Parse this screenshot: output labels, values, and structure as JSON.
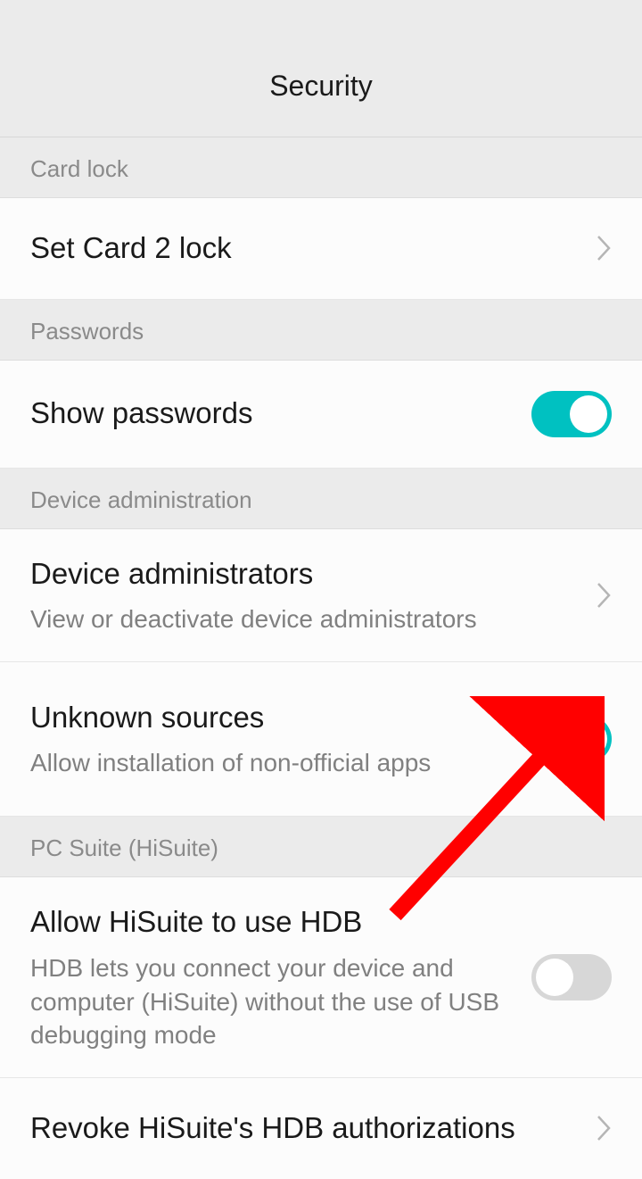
{
  "header": {
    "title": "Security"
  },
  "sections": {
    "card_lock": {
      "header": "Card lock",
      "set_card_lock": "Set Card 2 lock"
    },
    "passwords": {
      "header": "Passwords",
      "show_passwords": "Show passwords"
    },
    "device_admin": {
      "header": "Device administration",
      "device_admins_title": "Device administrators",
      "device_admins_sub": "View or deactivate device administrators",
      "unknown_sources_title": "Unknown sources",
      "unknown_sources_sub": "Allow installation of non-official apps"
    },
    "pc_suite": {
      "header": "PC Suite (HiSuite)",
      "allow_hdb_title": "Allow HiSuite to use HDB",
      "allow_hdb_sub": "HDB lets you connect your device and computer (HiSuite) without the use of USB debugging mode",
      "revoke_title": "Revoke HiSuite's HDB authorizations"
    }
  },
  "toggles": {
    "show_passwords": true,
    "unknown_sources": true,
    "allow_hdb": false
  }
}
